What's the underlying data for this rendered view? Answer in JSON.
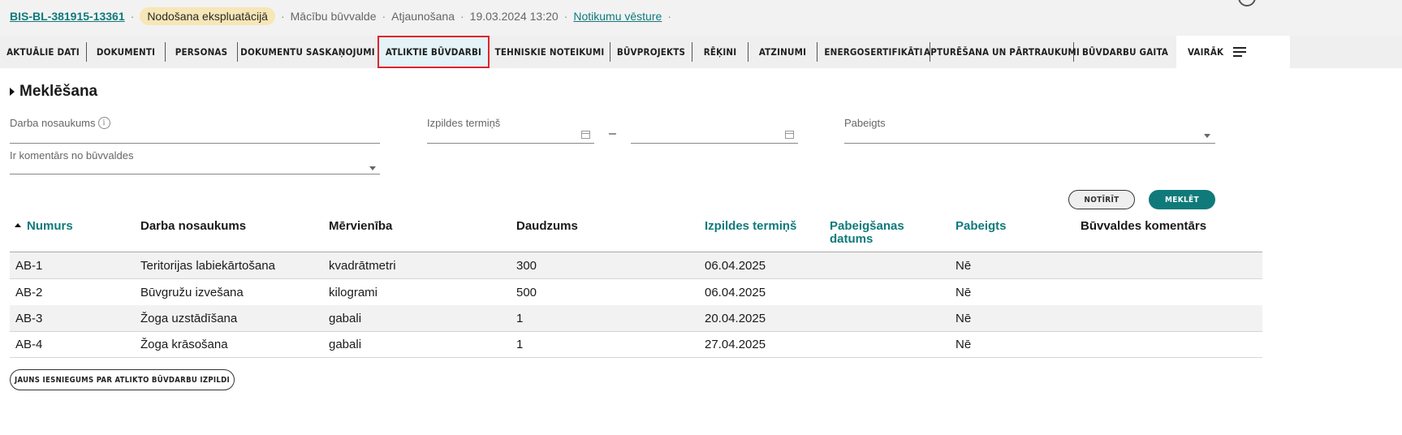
{
  "header": {
    "bis_id": "BIS-BL-381915-13361",
    "status": "Nodošana ekspluatācijā",
    "authority": "Mācību būvvalde",
    "procedure": "Atjaunošana",
    "datetime": "19.03.2024 13:20",
    "history_link": "Notikumu vēsture"
  },
  "tabs": [
    {
      "label": "AKTUĀLIE DATI"
    },
    {
      "label": "DOKUMENTI"
    },
    {
      "label": "PERSONAS"
    },
    {
      "label": "DOKUMENTU SASKAŅOJUMI"
    },
    {
      "label": "ATLIKTIE BŪVDARBI",
      "active": true
    },
    {
      "label": "TEHNISKIE NOTEIKUMI"
    },
    {
      "label": "BŪVPROJEKTS"
    },
    {
      "label": "RĒĶINI"
    },
    {
      "label": "ATZINUMI"
    },
    {
      "label": "ENERGOSERTIFIKĀTI"
    },
    {
      "label": "APTURĒŠANA UN PĀRTRAUKUMI"
    },
    {
      "label": "BŪVDARBU GAITA"
    }
  ],
  "more_tab": {
    "label": "VAIRĀK"
  },
  "search": {
    "title": "Meklēšana",
    "work_name_label": "Darba nosaukums",
    "term_label": "Izpildes termiņš",
    "range_separator": "–",
    "completed_label": "Pabeigts",
    "comment_label": "Ir komentārs no būvvaldes",
    "clear_button": "NOTĪRĪT",
    "search_button": "MEKLĒT"
  },
  "table": {
    "columns": [
      "Numurs",
      "Darba nosaukums",
      "Mērvienība",
      "Daudzums",
      "Izpildes termiņš",
      "Pabeigšanas datums",
      "Pabeigts",
      "Būvvaldes komentārs"
    ],
    "rows": [
      [
        "AB-1",
        "Teritorijas labiekārtošana",
        "kvadrātmetri",
        "300",
        "06.04.2025",
        "",
        "Nē",
        ""
      ],
      [
        "AB-2",
        "Būvgružu izvešana",
        "kilogrami",
        "500",
        "06.04.2025",
        "",
        "Nē",
        ""
      ],
      [
        "AB-3",
        "Žoga uzstādīšana",
        "gabali",
        "1",
        "20.04.2025",
        "",
        "Nē",
        ""
      ],
      [
        "AB-4",
        "Žoga krāsošana",
        "gabali",
        "1",
        "27.04.2025",
        "",
        "Nē",
        ""
      ]
    ]
  },
  "new_submission_button": "JAUNS IESNIEGUMS PAR ATLIKTO BŪVDARBU IZPILDI",
  "colors": {
    "accent": "#107a7a",
    "status_pill": "#f7e6b6",
    "active_tab_border": "#e1232b",
    "active_tab_bg": "#e3f3f7"
  }
}
